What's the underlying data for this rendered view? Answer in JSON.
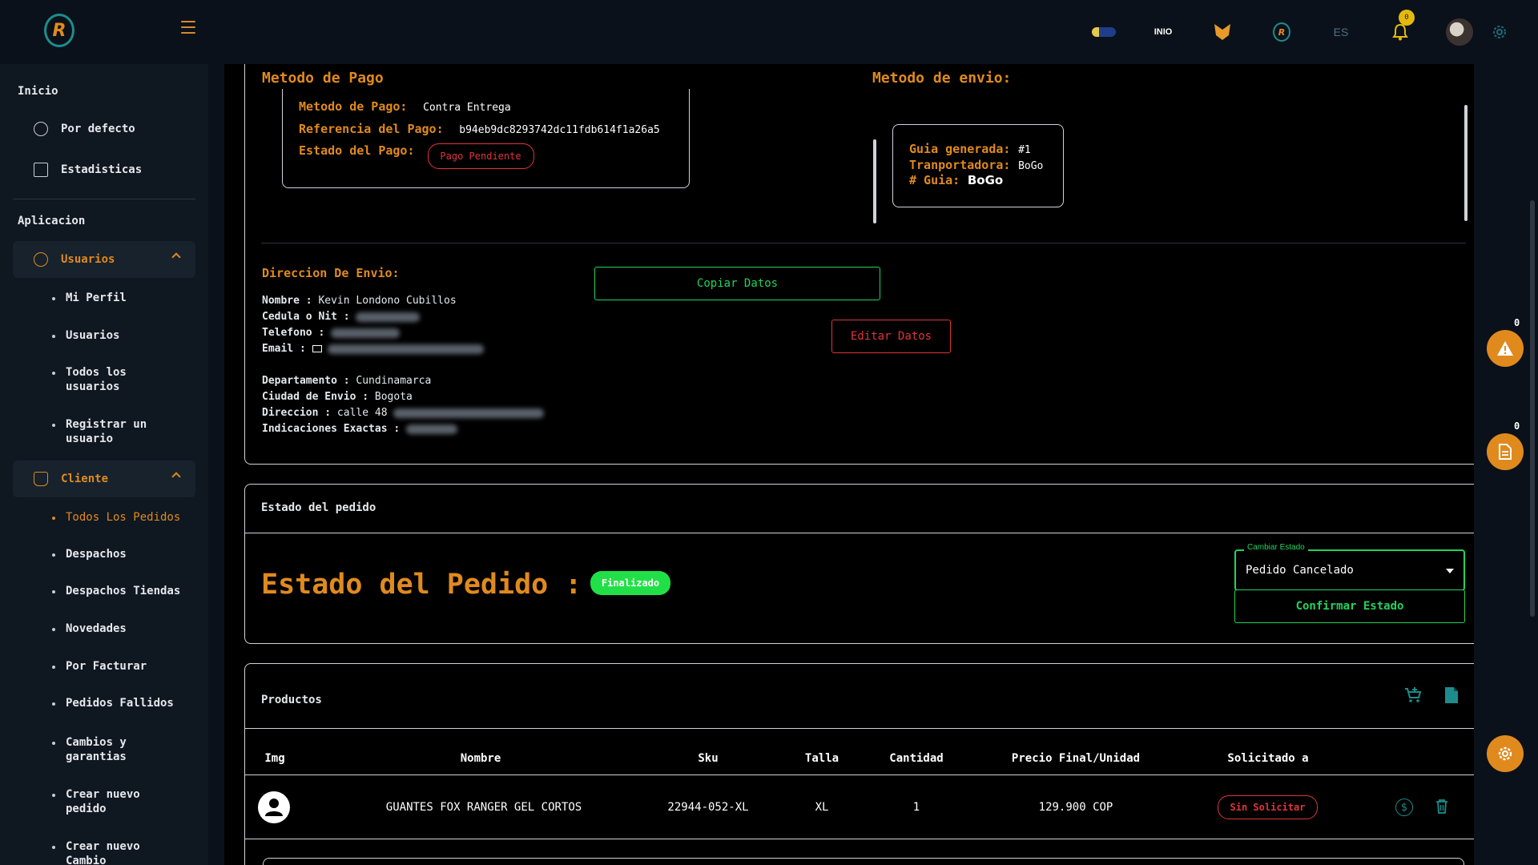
{
  "topbar": {
    "logo_letter": "R",
    "inio_text": "INIO",
    "language": "ES",
    "notifications_count": "0",
    "icons": [
      "menu-icon",
      "flag-icon",
      "inio-logo",
      "fox-icon",
      "brand-icon",
      "bell-icon",
      "avatar",
      "gear-icon"
    ]
  },
  "sidebar": {
    "home_section": "Inicio",
    "home_items": [
      "Por defecto",
      "Estadisticas"
    ],
    "app_section": "Aplicacion",
    "users_group": "Usuarios",
    "users_items": [
      "Mi Perfil",
      "Usuarios",
      "Todos los usuarios",
      "Registrar un usuario"
    ],
    "client_group": "Cliente",
    "client_items": [
      "Todos Los Pedidos",
      "Despachos",
      "Despachos Tiendas",
      "Novedades",
      "Por Facturar",
      "Pedidos Fallidos",
      "Cambios y garantias",
      "Crear nuevo pedido",
      "Crear nuevo Cambio"
    ]
  },
  "payment": {
    "title": "Metodo de Pago",
    "method_label": "Metodo de Pago:",
    "method_value": "Contra Entrega",
    "reference_label": "Referencia del Pago:",
    "reference_value": "b94eb9dc8293742dc11fdb614f1a26a5",
    "status_label": "Estado del Pago:",
    "status_value": "Pago Pendiente"
  },
  "shipping_method": {
    "title": "Metodo de envio:",
    "guide_label": "Guia generada:",
    "guide_value": "#1",
    "carrier_label": "Tranportadora:",
    "carrier_value": "BoGo",
    "number_label": "# Guia:",
    "number_value": "BoGo"
  },
  "address": {
    "title": "Direccion De Envio:",
    "name_label": "Nombre :",
    "name_value": "Kevin Londono Cubillos",
    "id_label": "Cedula o Nit :",
    "phone_label": "Telefono :",
    "email_label": "Email :",
    "department_label": "Departamento :",
    "department_value": "Cundinamarca",
    "city_label": "Ciudad de Envio :",
    "city_value": "Bogota",
    "address_label": "Direccion :",
    "address_value": "calle 48",
    "notes_label": "Indicaciones Exactas :",
    "copy_button": "Copiar Datos",
    "edit_button": "Editar Datos"
  },
  "order_state": {
    "card_title": "Estado del pedido",
    "heading": "Estado del Pedido :",
    "status": "Finalizado",
    "select_label": "Cambiar Estado",
    "select_value": "Pedido Cancelado",
    "confirm_button": "Confirmar Estado"
  },
  "products": {
    "card_title": "Productos",
    "columns": [
      "Img",
      "Nombre",
      "Sku",
      "Talla",
      "Cantidad",
      "Precio Final/Unidad",
      "Solicitado a"
    ],
    "rows": [
      {
        "name": "GUANTES FOX RANGER GEL CORTOS",
        "sku": "22944-052-XL",
        "size": "XL",
        "quantity": "1",
        "price": "129.900 COP",
        "requested": "Sin Solicitar"
      }
    ]
  },
  "fabs": {
    "alerts_count": "0",
    "docs_count": "0"
  },
  "colors": {
    "accent_orange": "#e08a1e",
    "accent_green": "#22d35d",
    "danger_red": "#e0343a",
    "teal": "#1c8d8c"
  }
}
